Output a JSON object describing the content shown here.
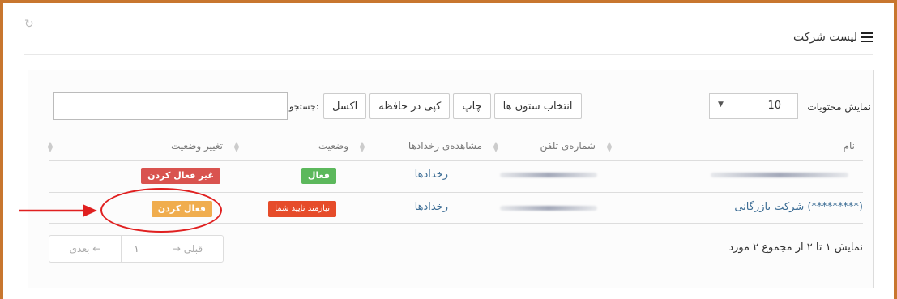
{
  "panel": {
    "title": "لیست شرکت",
    "refresh_icon": "refresh-icon",
    "list_icon": "list-icon"
  },
  "controls": {
    "length_label": "نمایش محتویات",
    "length_value": "10",
    "buttons": [
      "اکسل",
      "کپی در حافظه",
      "چاپ",
      "انتخاب ستون ها"
    ],
    "search_label": "جستجو:",
    "search_value": ""
  },
  "table": {
    "columns": [
      "نام",
      "شماره‌ی تلفن",
      "مشاهده‌ی رخدادها",
      "وضعیت",
      "تغییر وضعیت"
    ],
    "rows": [
      {
        "name": "",
        "phone": "",
        "events_link": "رخدادها",
        "status": "فعال",
        "action": "غیر فعال کردن"
      },
      {
        "name": "شرکت بازرگانی (*********)",
        "phone": "",
        "events_link": "رخدادها",
        "status": "نیازمند تایید شما",
        "action": "فعال کردن"
      }
    ]
  },
  "pagination": {
    "next": "بعدی ←",
    "page": "۱",
    "prev": "→ قبلی",
    "info": "نمایش ۱ تا ۲ از مجموع ۲ مورد"
  },
  "colors": {
    "frame": "#c8762e",
    "link": "#3c6d95",
    "danger": "#d9534f",
    "success": "#5cb85c",
    "warning": "#f0ad4e",
    "annotation": "#e02020"
  }
}
